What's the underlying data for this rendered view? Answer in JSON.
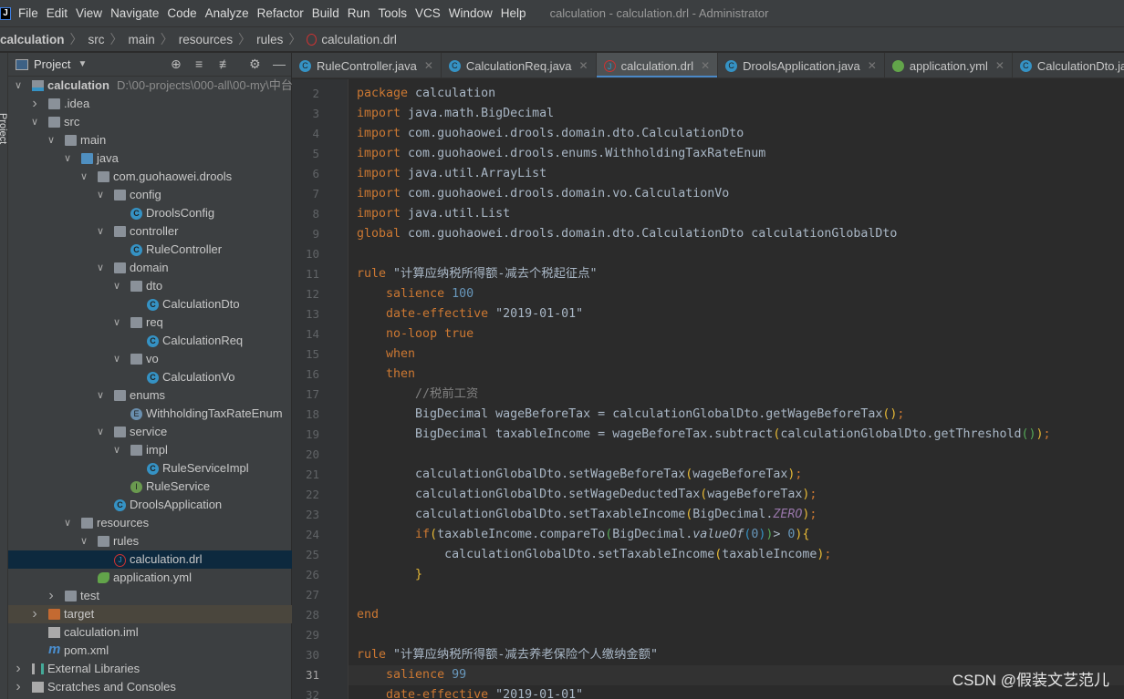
{
  "menubar": {
    "items": [
      "File",
      "Edit",
      "View",
      "Navigate",
      "Code",
      "Analyze",
      "Refactor",
      "Build",
      "Run",
      "Tools",
      "VCS",
      "Window",
      "Help"
    ],
    "window_title": "calculation - calculation.drl - Administrator"
  },
  "breadcrumb": [
    "calculation",
    "src",
    "main",
    "resources",
    "rules",
    "calculation.drl"
  ],
  "side_strip": {
    "label": "Project"
  },
  "panel": {
    "title": "Project",
    "icons": [
      "locate-icon",
      "expand-all-icon",
      "collapse-all-icon",
      "gear-icon",
      "minimize-icon"
    ]
  },
  "tree": [
    {
      "level": 0,
      "chev": "open",
      "icon": "module",
      "label": "calculation",
      "bold": true,
      "path": "D:\\00-projects\\000-all\\00-my\\中台"
    },
    {
      "level": 1,
      "chev": "closed",
      "icon": "folder",
      "label": ".idea"
    },
    {
      "level": 1,
      "chev": "open",
      "icon": "folder",
      "label": "src"
    },
    {
      "level": 2,
      "chev": "open",
      "icon": "folder",
      "label": "main"
    },
    {
      "level": 3,
      "chev": "open",
      "icon": "folder-blue",
      "label": "java"
    },
    {
      "level": 4,
      "chev": "open",
      "icon": "pkg",
      "label": "com.guohaowei.drools"
    },
    {
      "level": 5,
      "chev": "open",
      "icon": "pkg",
      "label": "config"
    },
    {
      "level": 6,
      "icon": "class",
      "label": "DroolsConfig"
    },
    {
      "level": 5,
      "chev": "open",
      "icon": "pkg",
      "label": "controller"
    },
    {
      "level": 6,
      "icon": "class",
      "label": "RuleController"
    },
    {
      "level": 5,
      "chev": "open",
      "icon": "pkg",
      "label": "domain"
    },
    {
      "level": 6,
      "chev": "open",
      "icon": "pkg",
      "label": "dto"
    },
    {
      "level": 7,
      "icon": "class",
      "label": "CalculationDto"
    },
    {
      "level": 6,
      "chev": "open",
      "icon": "pkg",
      "label": "req"
    },
    {
      "level": 7,
      "icon": "class",
      "label": "CalculationReq"
    },
    {
      "level": 6,
      "chev": "open",
      "icon": "pkg",
      "label": "vo"
    },
    {
      "level": 7,
      "icon": "class",
      "label": "CalculationVo"
    },
    {
      "level": 5,
      "chev": "open",
      "icon": "pkg",
      "label": "enums"
    },
    {
      "level": 6,
      "icon": "enum",
      "label": "WithholdingTaxRateEnum"
    },
    {
      "level": 5,
      "chev": "open",
      "icon": "pkg",
      "label": "service"
    },
    {
      "level": 6,
      "chev": "open",
      "icon": "pkg",
      "label": "impl"
    },
    {
      "level": 7,
      "icon": "class",
      "label": "RuleServiceImpl"
    },
    {
      "level": 6,
      "icon": "iface",
      "label": "RuleService"
    },
    {
      "level": 5,
      "icon": "class",
      "label": "DroolsApplication"
    },
    {
      "level": 3,
      "chev": "open",
      "icon": "folder",
      "label": "resources"
    },
    {
      "level": 4,
      "chev": "open",
      "icon": "folder",
      "label": "rules"
    },
    {
      "level": 5,
      "icon": "drl",
      "label": "calculation.drl",
      "selected": true
    },
    {
      "level": 4,
      "icon": "yml",
      "label": "application.yml"
    },
    {
      "level": 2,
      "chev": "closed",
      "icon": "folder",
      "label": "test"
    },
    {
      "level": 1,
      "chev": "closed",
      "icon": "folder-orange",
      "label": "target",
      "highlight": true
    },
    {
      "level": 1,
      "icon": "file",
      "label": "calculation.iml"
    },
    {
      "level": 1,
      "icon": "mvn",
      "label": "pom.xml"
    },
    {
      "level": 0,
      "chev": "closed",
      "icon": "lib",
      "label": "External Libraries"
    },
    {
      "level": 0,
      "chev": "closed",
      "icon": "file",
      "label": "Scratches and Consoles"
    }
  ],
  "tabs": [
    {
      "label": "RuleController.java",
      "icon": "class"
    },
    {
      "label": "CalculationReq.java",
      "icon": "class"
    },
    {
      "label": "calculation.drl",
      "icon": "drl",
      "active": true
    },
    {
      "label": "DroolsApplication.java",
      "icon": "class"
    },
    {
      "label": "application.yml",
      "icon": "yml"
    },
    {
      "label": "CalculationDto.java",
      "icon": "class"
    }
  ],
  "editor": {
    "current_line": 31,
    "first_line": 2,
    "lines": [
      [
        [
          "kw",
          "package "
        ],
        [
          "",
          "calculation"
        ]
      ],
      [
        [
          "kw",
          "import "
        ],
        [
          "",
          "java.math.BigDecimal"
        ]
      ],
      [
        [
          "kw",
          "import "
        ],
        [
          "",
          "com.guohaowei.drools.domain.dto.CalculationDto"
        ]
      ],
      [
        [
          "kw",
          "import "
        ],
        [
          "",
          "com.guohaowei.drools.enums.WithholdingTaxRateEnum"
        ]
      ],
      [
        [
          "kw",
          "import "
        ],
        [
          "",
          "java.util.ArrayList"
        ]
      ],
      [
        [
          "kw",
          "import "
        ],
        [
          "",
          "com.guohaowei.drools.domain.vo.CalculationVo"
        ]
      ],
      [
        [
          "kw",
          "import "
        ],
        [
          "",
          "java.util.List"
        ]
      ],
      [
        [
          "kw",
          "global "
        ],
        [
          "",
          "com.guohaowei.drools.domain.dto.CalculationDto calculationGlobalDto"
        ]
      ],
      [],
      [
        [
          "kw",
          "rule "
        ],
        [
          "str",
          "\"计算应纳税所得额-减去个税起征点\""
        ]
      ],
      [
        [
          "",
          "    "
        ],
        [
          "kw",
          "salience "
        ],
        [
          "num",
          "100"
        ]
      ],
      [
        [
          "",
          "    "
        ],
        [
          "kw",
          "date-effective "
        ],
        [
          "str",
          "\"2019-01-01\""
        ]
      ],
      [
        [
          "",
          "    "
        ],
        [
          "kw",
          "no-loop true"
        ]
      ],
      [
        [
          "",
          "    "
        ],
        [
          "kw",
          "when"
        ]
      ],
      [
        [
          "",
          "    "
        ],
        [
          "kw",
          "then"
        ]
      ],
      [
        [
          "",
          "        "
        ],
        [
          "cm",
          "//税前工资"
        ]
      ],
      [
        [
          "",
          "        BigDecimal wageBeforeTax = calculationGlobalDto.getWageBeforeTax"
        ],
        [
          "b1",
          "()"
        ],
        [
          "kw",
          ";"
        ]
      ],
      [
        [
          "",
          "        BigDecimal taxableIncome = wageBeforeTax.subtract"
        ],
        [
          "b1",
          "("
        ],
        [
          "",
          "calculationGlobalDto.getThreshold"
        ],
        [
          "b2",
          "()"
        ],
        [
          "b1",
          ")"
        ],
        [
          "kw",
          ";"
        ]
      ],
      [],
      [
        [
          "",
          "        calculationGlobalDto.setWageBeforeTax"
        ],
        [
          "b1",
          "("
        ],
        [
          "",
          "wageBeforeTax"
        ],
        [
          "b1",
          ")"
        ],
        [
          "kw",
          ";"
        ]
      ],
      [
        [
          "",
          "        calculationGlobalDto.setWageDeductedTax"
        ],
        [
          "b1",
          "("
        ],
        [
          "",
          "wageBeforeTax"
        ],
        [
          "b1",
          ")"
        ],
        [
          "kw",
          ";"
        ]
      ],
      [
        [
          "",
          "        calculationGlobalDto.setTaxableIncome"
        ],
        [
          "b1",
          "("
        ],
        [
          "",
          "BigDecimal."
        ],
        [
          "st",
          "ZERO"
        ],
        [
          "b1",
          ")"
        ],
        [
          "kw",
          ";"
        ]
      ],
      [
        [
          "",
          "        "
        ],
        [
          "kw",
          "if"
        ],
        [
          "b1",
          "("
        ],
        [
          "",
          "taxableIncome.compareTo"
        ],
        [
          "b2",
          "("
        ],
        [
          "",
          "BigDecimal."
        ],
        [
          "it",
          "valueOf"
        ],
        [
          "b3",
          "("
        ],
        [
          "num",
          "0"
        ],
        [
          "b3",
          ")"
        ],
        [
          "b2",
          ")"
        ],
        [
          "",
          ">"
        ],
        [
          "num",
          " 0"
        ],
        [
          "b1",
          ")"
        ],
        [
          "b1",
          "{"
        ]
      ],
      [
        [
          "",
          "            calculationGlobalDto.setTaxableIncome"
        ],
        [
          "b1",
          "("
        ],
        [
          "",
          "taxableIncome"
        ],
        [
          "b1",
          ")"
        ],
        [
          "kw",
          ";"
        ]
      ],
      [
        [
          "",
          "        "
        ],
        [
          "b1",
          "}"
        ]
      ],
      [],
      [
        [
          "kw",
          "end"
        ]
      ],
      [],
      [
        [
          "kw",
          "rule "
        ],
        [
          "str",
          "\"计算应纳税所得额-减去养老保险个人缴纳金额\""
        ]
      ],
      [
        [
          "",
          "    "
        ],
        [
          "kw",
          "salience "
        ],
        [
          "num",
          "99"
        ]
      ],
      [
        [
          "",
          "    "
        ],
        [
          "kw",
          "date-effective "
        ],
        [
          "str",
          "\"2019-01-01\""
        ]
      ]
    ]
  },
  "watermark": "CSDN @假装文艺范儿"
}
